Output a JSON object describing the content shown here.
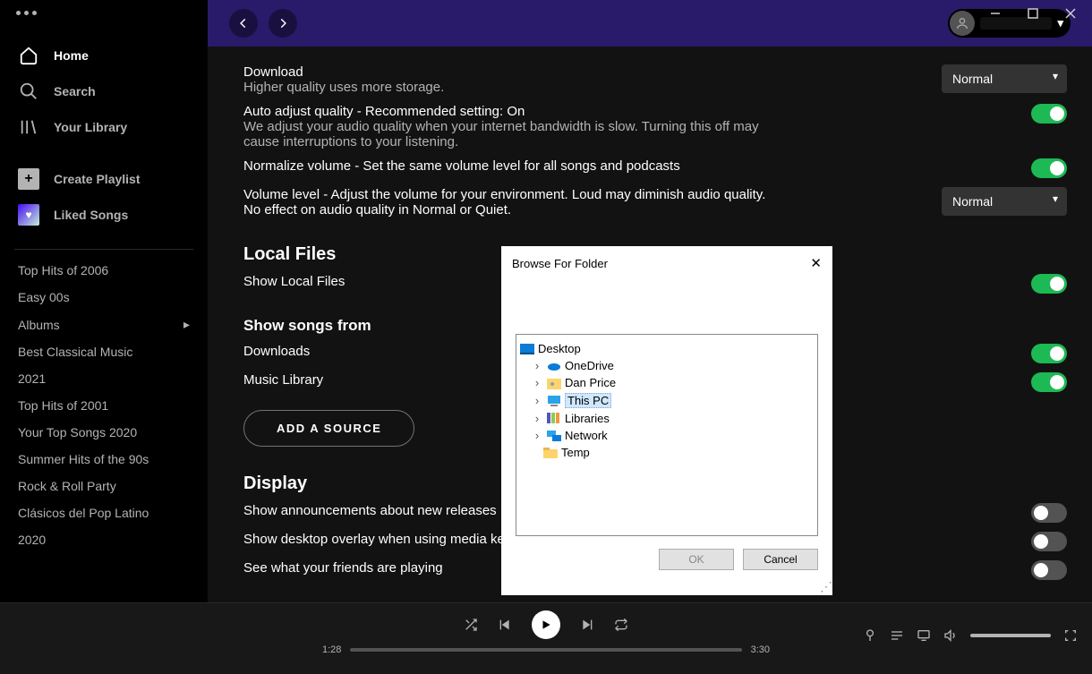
{
  "window": {
    "min": "−",
    "max": "□",
    "close": "✕"
  },
  "sidebar": {
    "home": "Home",
    "search": "Search",
    "library": "Your Library",
    "create": "Create Playlist",
    "liked": "Liked Songs",
    "playlists": [
      "Top Hits of 2006",
      "Easy 00s",
      "Albums",
      "Best Classical Music",
      "2021",
      "Top Hits of 2001",
      "Your Top Songs 2020",
      "Summer Hits of the 90s",
      "Rock & Roll Party",
      "Clásicos del Pop Latino",
      "2020"
    ]
  },
  "settings": {
    "download_t": "Download",
    "download_s": "Higher quality uses more storage.",
    "download_sel": "Normal",
    "auto_t": "Auto adjust quality - Recommended setting: On",
    "auto_s": "We adjust your audio quality when your internet bandwidth is slow. Turning this off may cause interruptions to your listening.",
    "norm_t": "Normalize volume - Set the same volume level for all songs and podcasts",
    "vol_t": "Volume level - Adjust the volume for your environment. Loud may diminish audio quality. No effect on audio quality in Normal or Quiet.",
    "vol_sel": "Normal",
    "local_h": "Local Files",
    "local_t": "Show Local Files",
    "songs_h": "Show songs from",
    "dl": "Downloads",
    "ml": "Music Library",
    "add": "ADD A SOURCE",
    "disp_h": "Display",
    "d1": "Show announcements about new releases",
    "d2": "Show desktop overlay when using media keys",
    "d3": "See what your friends are playing"
  },
  "dialog": {
    "title": "Browse For Folder",
    "nodes": {
      "desktop": "Desktop",
      "onedrive": "OneDrive",
      "user": "Dan Price",
      "thispc": "This PC",
      "libraries": "Libraries",
      "network": "Network",
      "temp": "Temp"
    },
    "ok": "OK",
    "cancel": "Cancel"
  },
  "player": {
    "cur": "1:28",
    "dur": "3:30"
  }
}
